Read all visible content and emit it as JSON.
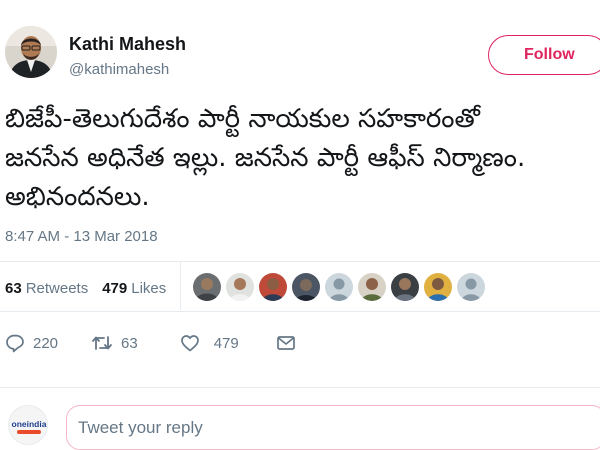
{
  "tweet": {
    "author": {
      "display_name": "Kathi Mahesh",
      "handle": "@kathimahesh"
    },
    "follow_label": "Follow",
    "text_lines": [
      "బిజేపీ-తెలుగుదేశం పార్టీ నాయకుల సహకారంతో",
      "జనసేన అధినేత ఇల్లు. జనసేన పార్టీ ఆఫీస్ నిర్మాణం.",
      "అభినందనలు."
    ],
    "timestamp": "8:47 AM - 13 Mar 2018",
    "stats": {
      "retweets_count": "63",
      "retweets_label": "Retweets",
      "likes_count": "479",
      "likes_label": "Likes"
    },
    "liker_avatars": [
      "avatar-1",
      "avatar-2",
      "avatar-3",
      "avatar-4",
      "avatar-5",
      "avatar-6",
      "avatar-7",
      "avatar-8",
      "avatar-9"
    ],
    "actions": {
      "reply_count": "220",
      "retweet_count": "63",
      "like_count": "479"
    },
    "reply": {
      "placeholder": "Tweet your reply",
      "brand_logo_text": "oneindia"
    }
  },
  "colors": {
    "accent": "#e0245e",
    "muted": "#657786",
    "text": "#14171a",
    "divider": "#e6ecf0"
  }
}
